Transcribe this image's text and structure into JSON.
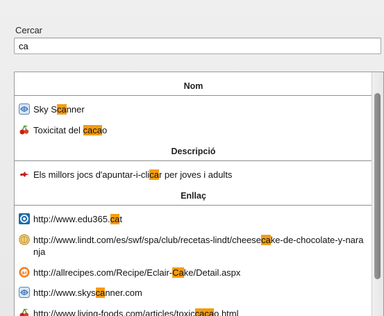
{
  "search": {
    "label": "Cercar",
    "value": "ca"
  },
  "sections": {
    "name": {
      "title": "Nom",
      "items": [
        {
          "icon": "skyscanner-icon",
          "before": "Sky S",
          "match": "ca",
          "after": "nner"
        },
        {
          "icon": "cherry-icon",
          "before": "Toxicitat del ",
          "match": "caca",
          "after": "o"
        }
      ]
    },
    "description": {
      "title": "Descripció",
      "items": [
        {
          "icon": "red-shooter-icon",
          "before": "Els millors jocs d'apuntar-i-cli",
          "match": "ca",
          "after": "r per joves i adults"
        }
      ]
    },
    "link": {
      "title": "Enllaç",
      "items": [
        {
          "icon": "edu365-icon",
          "before": "http://www.edu365.",
          "match": "ca",
          "after": "t"
        },
        {
          "icon": "lindt-icon",
          "before": "http://www.lindt.com/es/swf/spa/club/recetas-lindt/cheese",
          "match": "ca",
          "after": "ke-de-chocolate-y-naranja"
        },
        {
          "icon": "allrecipes-icon",
          "before": "http://allrecipes.com/Recipe/Eclair-",
          "match": "Ca",
          "after": "ke/Detail.aspx"
        },
        {
          "icon": "skyscanner-icon",
          "before": "http://www.skys",
          "match": "ca",
          "after": "nner.com"
        },
        {
          "icon": "cherry-icon",
          "before": "http://www.living-foods.com/articles/toxic",
          "match": "caca",
          "after": "o.html"
        }
      ]
    }
  },
  "colors": {
    "highlight": "#f39c12",
    "divider": "#8e8e8e"
  }
}
